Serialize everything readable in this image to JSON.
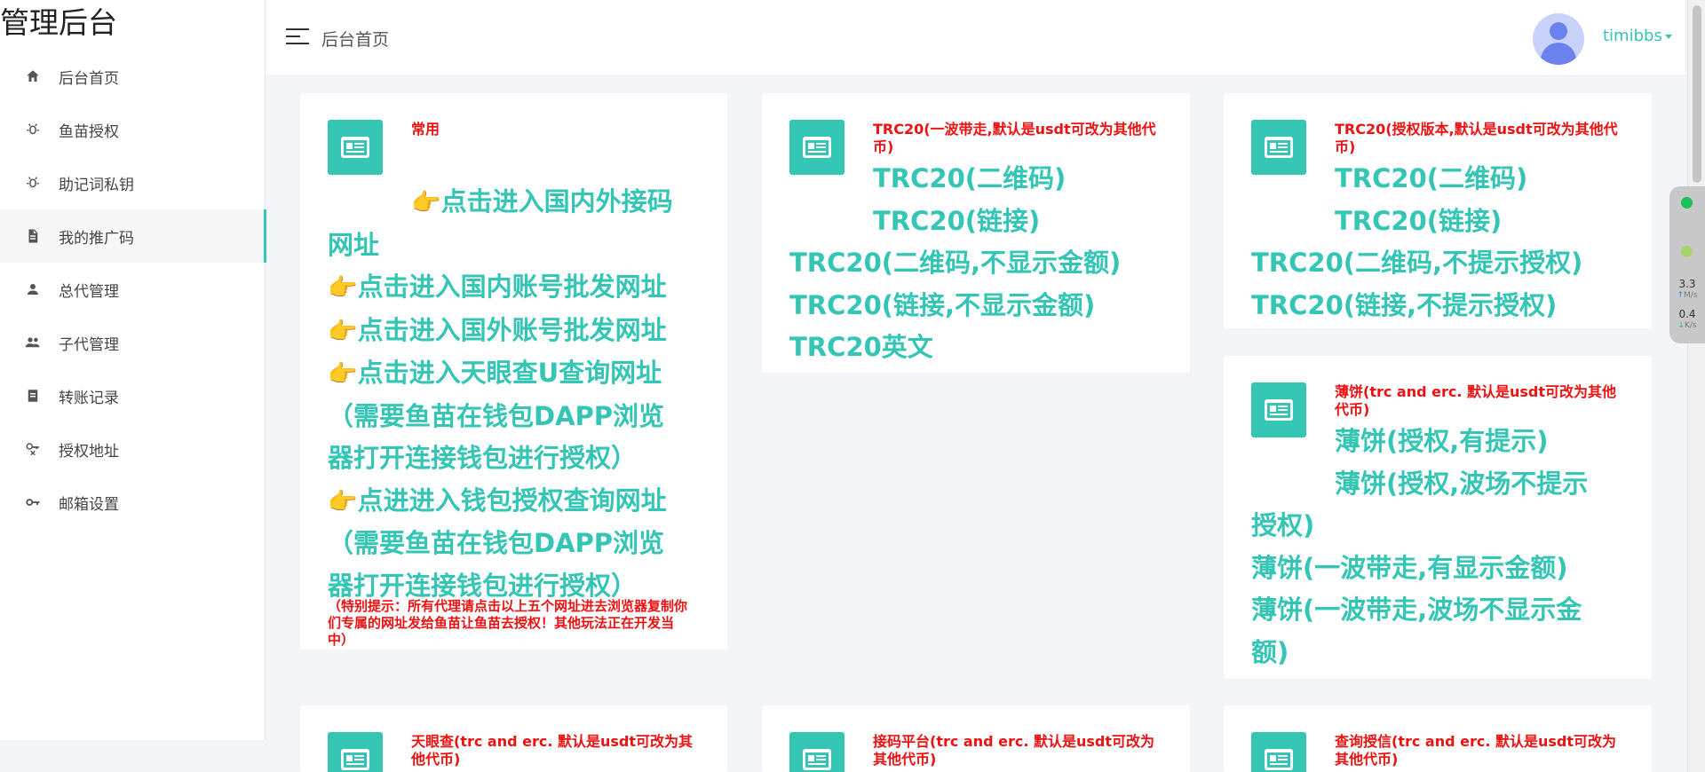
{
  "brand": "管理后台",
  "nav": [
    {
      "label": "后台首页",
      "icon": "home-icon"
    },
    {
      "label": "鱼苗授权",
      "icon": "bug-icon"
    },
    {
      "label": "助记词私钥",
      "icon": "bug-icon"
    },
    {
      "label": "我的推广码",
      "icon": "document-icon"
    },
    {
      "label": "总代管理",
      "icon": "user-icon"
    },
    {
      "label": "子代管理",
      "icon": "users-icon"
    },
    {
      "label": "转账记录",
      "icon": "receipt-icon"
    },
    {
      "label": "授权地址",
      "icon": "key-x-icon"
    },
    {
      "label": "邮箱设置",
      "icon": "key-icon"
    }
  ],
  "header": {
    "title": "后台首页",
    "username": "timibbs"
  },
  "cards": {
    "common": {
      "title": "常用",
      "hand": "👉",
      "link1": "点击进入国内外接码",
      "link1_cont": "网址",
      "link2": "点击进入国内账号批发网址",
      "link3": "点击进入国外账号批发网址",
      "link4": "点击进入天眼查U查询网址",
      "link4_note1": "（需要鱼苗在钱包DAPP浏览",
      "link4_note2": "器打开连接钱包进行授权）",
      "link5": "点进进入钱包授权查询网址",
      "link5_note1": "（需要鱼苗在钱包DAPP浏览",
      "link5_note2": "器打开连接钱包进行授权）",
      "note": "（特别提示：所有代理请点击以上五个网址进去浏览器复制你们专属的网址发给鱼苗让鱼苗去授权！其他玩法正在开发当中）"
    },
    "trc20_once": {
      "title": "TRC20(一波带走,默认是usdt可改为其他代币)",
      "link1": "TRC20(二维码)",
      "link2": "TRC20(链接)",
      "link3": "TRC20(二维码,不显示金额)",
      "link4": "TRC20(链接,不显示金额)",
      "link5": "TRC20英文"
    },
    "trc20_auth": {
      "title": "TRC20(授权版本,默认是usdt可改为其他代币)",
      "link1": "TRC20(二维码)",
      "link2": "TRC20(链接)",
      "link3": "TRC20(二维码,不提示授权)",
      "link4": "TRC20(链接,不提示授权)"
    },
    "pancake": {
      "title": "薄饼(trc and erc. 默认是usdt可改为其他代币)",
      "link1": "薄饼(授权,有提示)",
      "link2a": "薄饼(授权,波场不提示",
      "link2b": "授权)",
      "link3": "薄饼(一波带走,有显示金额)",
      "link4a": "薄饼(一波带走,波场不显示金",
      "link4b": "额)"
    },
    "tianyan": {
      "title": "天眼查(trc and erc. 默认是usdt可改为其他代币)"
    },
    "jiema": {
      "title": "接码平台(trc and erc. 默认是usdt可改为其他代币)"
    },
    "chaxun": {
      "title": "查询授信(trc and erc. 默认是usdt可改为其他代币)"
    }
  },
  "net_widget": {
    "up_value": "3.3",
    "up_unit": "M/s",
    "down_value": "0.4",
    "down_unit": "K/s",
    "accent_green": "#19c15e"
  },
  "colors": {
    "accent": "#34c5b5",
    "warning_red": "#ee1111"
  }
}
